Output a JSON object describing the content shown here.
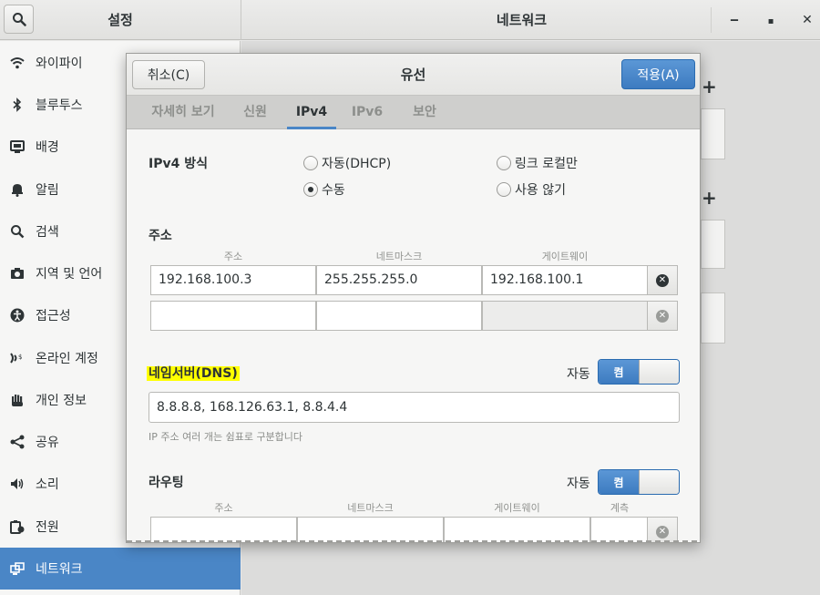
{
  "window": {
    "sidebar_title": "설정",
    "title": "네트워크",
    "minimize": "‒",
    "maximize": "▪",
    "close": "✕"
  },
  "sidebar": {
    "items": [
      {
        "label": "와이파이",
        "icon": "wifi-icon"
      },
      {
        "label": "블루투스",
        "icon": "bluetooth-icon"
      },
      {
        "label": "배경",
        "icon": "background-icon"
      },
      {
        "label": "알림",
        "icon": "bell-icon"
      },
      {
        "label": "검색",
        "icon": "search-icon"
      },
      {
        "label": "지역 및 언어",
        "icon": "camera-icon"
      },
      {
        "label": "접근성",
        "icon": "accessibility-icon"
      },
      {
        "label": "온라인 계정",
        "icon": "online-accounts-icon"
      },
      {
        "label": "개인 정보",
        "icon": "hand-icon"
      },
      {
        "label": "공유",
        "icon": "share-icon"
      },
      {
        "label": "소리",
        "icon": "speaker-icon"
      },
      {
        "label": "전원",
        "icon": "power-icon"
      },
      {
        "label": "네트워크",
        "icon": "network-icon",
        "active": true
      }
    ]
  },
  "dialog": {
    "cancel": "취소(C)",
    "title": "유선",
    "apply": "적용(A)",
    "tabs": [
      "자세히 보기",
      "신원",
      "IPv4",
      "IPv6",
      "보안"
    ],
    "active_tab": "IPv4",
    "ipv4_method": {
      "label": "IPv4 방식",
      "options": [
        "자동(DHCP)",
        "링크 로컬만",
        "수동",
        "사용 않기"
      ],
      "selected": "수동"
    },
    "address": {
      "label": "주소",
      "columns": [
        "주소",
        "네트마스크",
        "게이트웨이"
      ],
      "rows": [
        [
          "192.168.100.3",
          "255.255.255.0",
          "192.168.100.1"
        ],
        [
          "",
          "",
          ""
        ]
      ]
    },
    "dns": {
      "label": "네임서버(DNS)",
      "auto_label": "자동",
      "switch_label": "켬",
      "value": "8.8.8.8, 168.126.63.1, 8.8.4.4",
      "hint": "IP 주소 여러 개는 쉼표로 구분합니다"
    },
    "routes": {
      "label": "라우팅",
      "auto_label": "자동",
      "switch_label": "켬",
      "columns": [
        "주소",
        "네트마스크",
        "게이트웨이",
        "계측"
      ]
    }
  },
  "colors": {
    "accent": "#4a86c6",
    "highlight": "#ffff00"
  }
}
